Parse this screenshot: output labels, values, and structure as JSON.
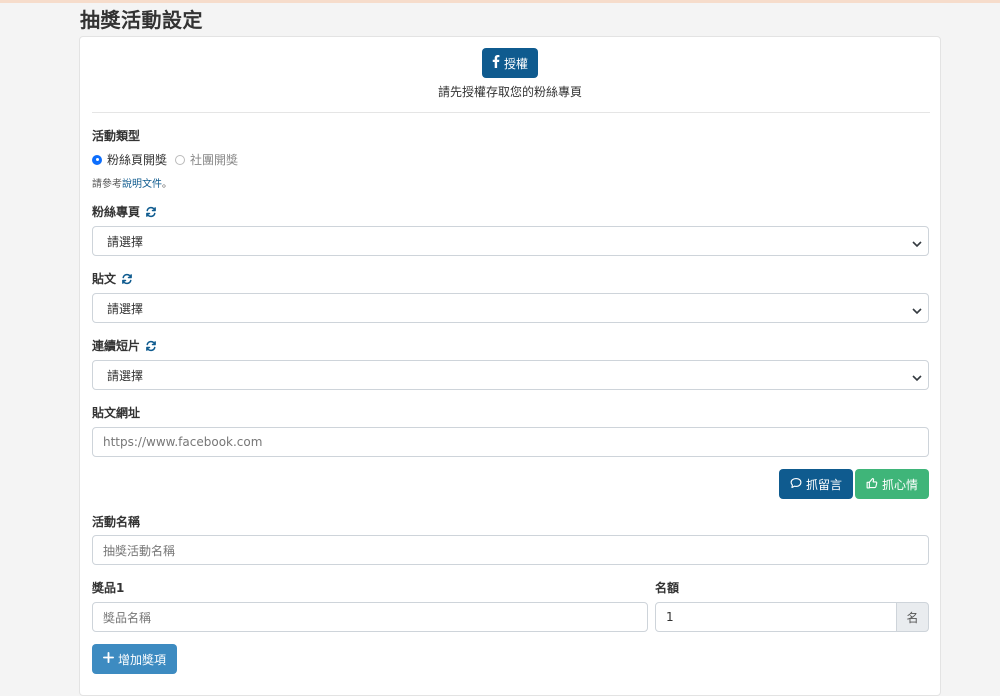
{
  "page": {
    "title": "抽獎活動設定"
  },
  "auth": {
    "button_label": "授權",
    "hint": "請先授權存取您的粉絲專頁"
  },
  "activity_type": {
    "label": "活動類型",
    "options": [
      {
        "label": "粉絲頁開獎",
        "checked": true
      },
      {
        "label": "社團開獎",
        "checked": false
      }
    ],
    "doc_prefix": "請參考",
    "doc_link": "說明文件",
    "doc_suffix": "。"
  },
  "fan_page": {
    "label": "粉絲專頁",
    "value": "請選擇"
  },
  "post": {
    "label": "貼文",
    "value": "請選擇"
  },
  "reel": {
    "label": "連續短片",
    "value": "請選擇"
  },
  "post_url": {
    "label": "貼文網址",
    "placeholder": "https://www.facebook.com"
  },
  "actions": {
    "fetch_comments": "抓留言",
    "fetch_reactions": "抓心情"
  },
  "activity_name": {
    "label": "活動名稱",
    "placeholder": "抽獎活動名稱"
  },
  "prize": {
    "label": "獎品1",
    "placeholder": "獎品名稱"
  },
  "quota": {
    "label": "名額",
    "value": "1",
    "unit": "名"
  },
  "add_prize": {
    "label": "增加獎項"
  },
  "colors": {
    "primary": "#0f5b8f",
    "success": "#3fb579",
    "info": "#3d8bc1"
  },
  "icons": [
    "facebook-icon",
    "refresh-icon",
    "chevron-down-icon",
    "comment-icon",
    "thumbs-up-icon",
    "plus-icon"
  ]
}
